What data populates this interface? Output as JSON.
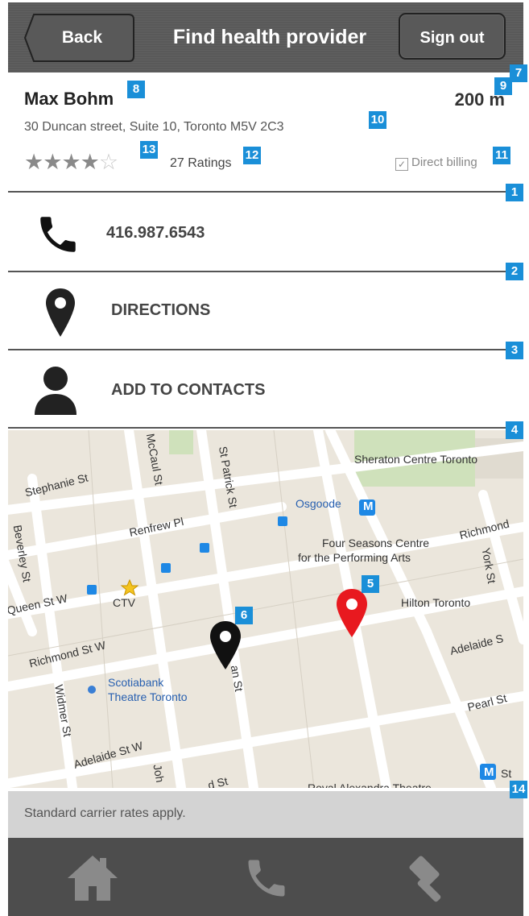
{
  "header": {
    "back_label": "Back",
    "title": "Find health provider",
    "signout_label": "Sign out"
  },
  "provider": {
    "name": "Max Bohm",
    "distance": "200 m",
    "address": "30 Duncan street, Suite 10, Toronto M5V 2C3",
    "rating": 4,
    "rating_max": 5,
    "ratings_count_label": "27 Ratings",
    "billing_label": "Direct billing"
  },
  "actions": {
    "phone": "416.987.6543",
    "directions": "DIRECTIONS",
    "contacts": "ADD TO CONTACTS"
  },
  "map": {
    "labels": {
      "stephanie": "Stephanie St",
      "mccaul": "McCaul St",
      "stpatrick": "St Patrick St",
      "sheraton": "Sheraton Centre Toronto",
      "osgoode": "Osgoode",
      "metro_symbol": "M",
      "beverley": "Beverley St",
      "renfrew": "Renfrew Pl",
      "fourseasons1": "Four Seasons Centre",
      "fourseasons2": "for the Performing Arts",
      "richmond_e": "Richmond",
      "york": "York St",
      "queen": "Queen St W",
      "ctv": "CTV",
      "hilton": "Hilton Toronto",
      "richmond_w": "Richmond St W",
      "adelaide_e": "Adelaide S",
      "scotiabank1": "Scotiabank",
      "scotiabank2": "Theatre Toronto",
      "duncan": "an St",
      "widmer": "Widmer St",
      "pearl": "Pearl St",
      "adelaide_w": "Adelaide St W",
      "john": "Joh",
      "bottom_st": "d St",
      "royal_alex": "Royal Alexandra Theatre",
      "metro_st": "St"
    }
  },
  "notice": "Standard carrier rates apply.",
  "badges": [
    "1",
    "2",
    "3",
    "4",
    "5",
    "6",
    "7",
    "8",
    "9",
    "10",
    "11",
    "12",
    "13",
    "14"
  ],
  "colors": {
    "header_bg": "#595959",
    "badge": "#1a8fd8",
    "footer_bg": "#4d4d4d",
    "notice_bg": "#d3d3d3",
    "pin_red": "#e8191f",
    "pin_black": "#111111"
  },
  "icons": {
    "phone": "phone-icon",
    "directions": "map-pin-icon",
    "contacts": "person-icon",
    "footer": [
      "home-icon",
      "phone-icon",
      "gavel-icon"
    ]
  }
}
